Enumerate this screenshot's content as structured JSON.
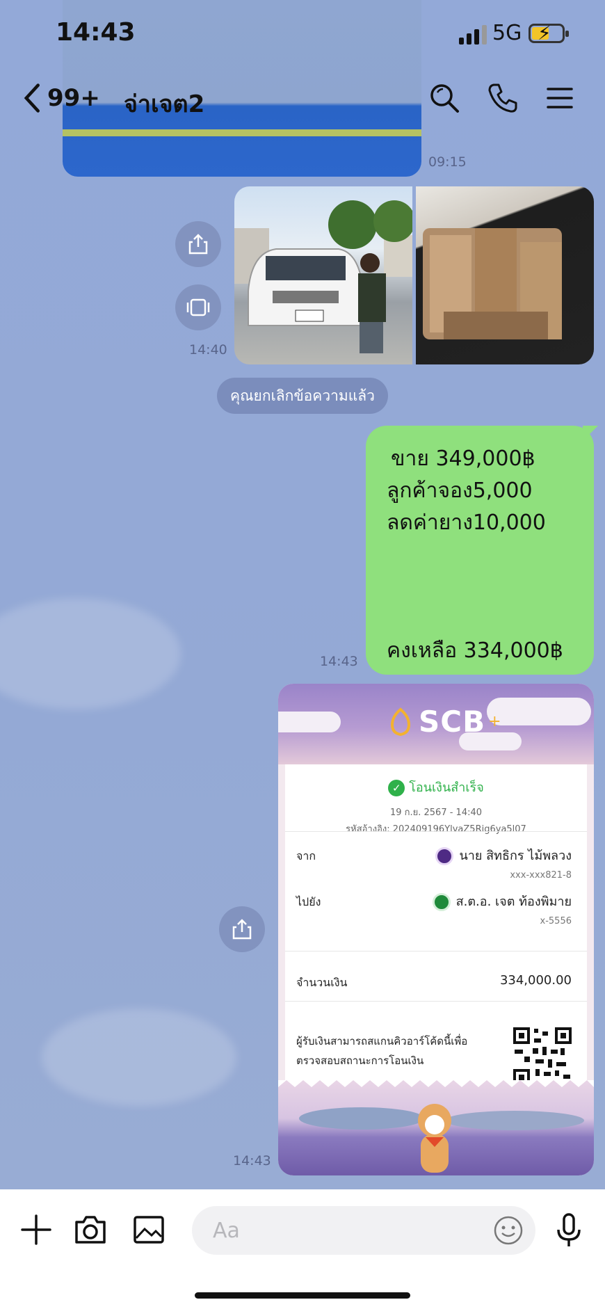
{
  "status": {
    "time": "14:43",
    "network": "5G"
  },
  "header": {
    "back_count": "99+",
    "title": "จ่าเจต2"
  },
  "messages": {
    "top_image_time": "09:15",
    "photos_time": "14:40",
    "system_notice": "คุณยกเลิกข้อความแล้ว",
    "sale_bubble": {
      "line1": "ขาย 349,000฿",
      "line2": "ลูกค้าจอง5,000",
      "line3": "ลดค่ายาง10,000",
      "line4": "คงเหลือ 334,000฿"
    },
    "sale_time": "14:43",
    "slip_time": "14:43"
  },
  "slip": {
    "brand": "SCB",
    "status": "โอนเงินสำเร็จ",
    "datetime": "19 ก.ย. 2567 - 14:40",
    "ref": "รหัสอ้างอิง: 202409196YlvaZ5Rig6ya5l07",
    "from_label": "จาก",
    "from_name": "นาย สิทธิกร ไม้พลวง",
    "from_account": "xxx-xxx821-8",
    "to_label": "ไปยัง",
    "to_name": "ส.ต.อ. เจต ท้องพิมาย",
    "to_account": "x-5556",
    "amount_label": "จำนวนเงิน",
    "amount": "334,000.00",
    "qr_note_1": "ผู้รับเงินสามารถสแกนคิวอาร์โค้ดนี้เพื่อ",
    "qr_note_2": "ตรวจสอบสถานะการโอนเงิน"
  },
  "input": {
    "placeholder": "Aa"
  },
  "colors": {
    "bubble_green": "#8fe07d",
    "chat_bg": "#93a8d6",
    "scb_purple": "#4e2a84",
    "success_green": "#2fb14a"
  }
}
